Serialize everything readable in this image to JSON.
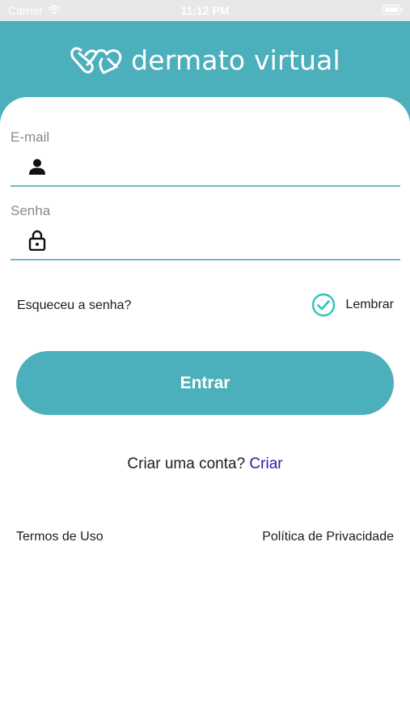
{
  "status_bar": {
    "carrier": "Carrier",
    "time": "11:12 PM"
  },
  "header": {
    "logo_text": "dermato virtual",
    "background_color": "#4cb0bc",
    "logo_icon": "heart-link-logo-icon"
  },
  "form": {
    "email": {
      "label": "E-mail",
      "value": "",
      "icon": "person-icon"
    },
    "password": {
      "label": "Senha",
      "value": "",
      "icon": "lock-icon"
    },
    "forgot_label": "Esqueceu a senha?",
    "remember": {
      "label": "Lembrar",
      "checked": true,
      "icon": "check-circle-icon",
      "color": "#2ec4b6"
    },
    "submit_label": "Entrar"
  },
  "signup": {
    "prompt": "Criar uma conta?",
    "link_label": "Criar",
    "link_color": "#2a1ca8"
  },
  "footer": {
    "terms_label": "Termos de Uso",
    "privacy_label": "Política de Privacidade"
  }
}
